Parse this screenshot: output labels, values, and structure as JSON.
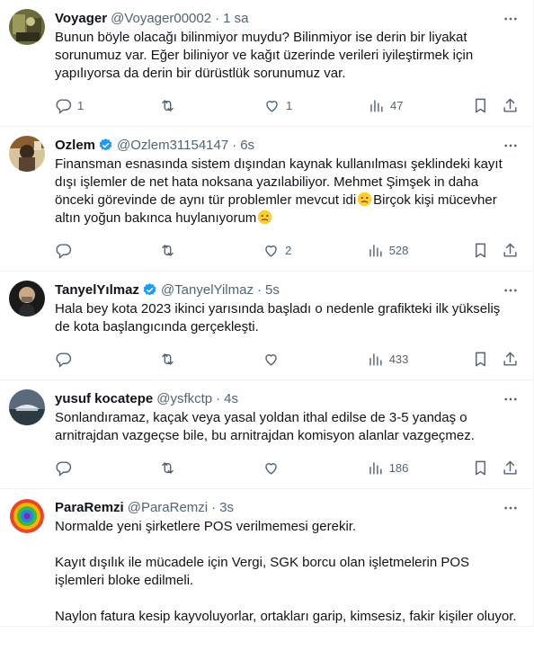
{
  "tweets": [
    {
      "name": "Voyager",
      "handle": "@Voyager00002",
      "time": "1 sa",
      "verified": false,
      "text": "Bunun böyle olacağı bilinmiyor muydu? Bilinmiyor ise derin bir liyakat sorunumuz var. Eğer biliniyor ve kağıt üzerinde verileri iyileştirmek için yapılıyorsa da derin bir dürüstlük sorunumuz var.",
      "replies": "1",
      "retweets": "",
      "likes": "1",
      "views": "47"
    },
    {
      "name": "Ozlem",
      "handle": "@Ozlem31154147",
      "time": "6s",
      "verified": true,
      "text_parts": [
        "Finansman esnasında sistem dışından kaynak kullanılması şeklindeki kayıt dışı işlemler de net hata noksana yazılabiliyor. Mehmet Şimşek in daha önceki görevinde de aynı tür problemler mevcut idi",
        "Birçok kişi mücevher altın yoğun bakınca huylanıyorum",
        ""
      ],
      "emoji": "confused-face-emoji",
      "replies": "",
      "retweets": "",
      "likes": "2",
      "views": "528"
    },
    {
      "name": "TanyelYılmaz",
      "handle": "@TanyelYilmaz",
      "time": "5s",
      "verified": true,
      "text": "Hala bey kota 2023 ikinci yarısında başladı o nedenle grafikteki ilk yükseliş de kota başlangıcında gerçekleşti.",
      "replies": "",
      "retweets": "",
      "likes": "",
      "views": "433"
    },
    {
      "name": "yusuf kocatepe",
      "handle": "@ysfkctp",
      "time": "4s",
      "verified": false,
      "text": "Sonlandıramaz, kaçak veya yasal yoldan ithal edilse de 3-5 yandaş o arnitrajdan vazgeçse bile, bu arnitrajdan komisyon alanlar vazgeçmez.",
      "replies": "",
      "retweets": "",
      "likes": "",
      "views": "186"
    },
    {
      "name": "ParaRemzi",
      "handle": "@ParaRemzi",
      "time": "3s",
      "verified": false,
      "text": "Normalde yeni şirketlere POS verilmemesi gerekir.\n\nKayıt dışılık ile mücadele için Vergi, SGK borcu olan işletmelerin POS işlemleri bloke edilmeli.\n\nNaylon fatura kesip kayvoluyorlar, ortakları garip, kimsesiz, fakir kişiler oluyor."
    }
  ],
  "dot": "·",
  "colors": {
    "verified": "#1d9bf0",
    "muted": "#536471",
    "text": "#0f1419",
    "border": "#eff3f4"
  }
}
